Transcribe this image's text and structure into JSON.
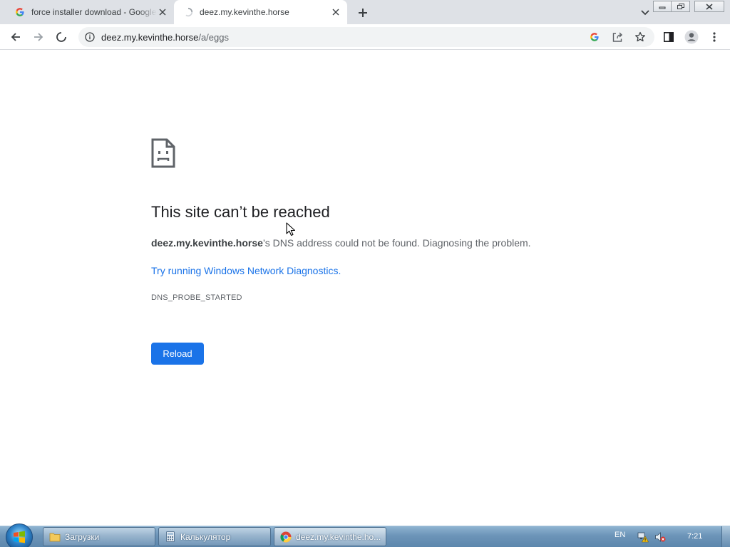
{
  "browser": {
    "tabs": [
      {
        "title": "force installer download - Google",
        "favicon": "google-icon",
        "active": false
      },
      {
        "title": "deez.my.kevinthe.horse",
        "favicon": "loading-spinner-icon",
        "active": true
      }
    ],
    "new_tab_icon": "plus-icon",
    "tab_search_icon": "chevron-down-icon",
    "window_controls": [
      "minimize-icon",
      "restore-icon",
      "close-icon"
    ],
    "toolbar": {
      "back_icon": "arrow-left-icon",
      "forward_icon": "arrow-right-icon",
      "stop_icon": "loading-spinner-icon",
      "site_info_icon": "info-icon",
      "url_host": "deez.my.kevinthe.horse",
      "url_path": "/a/eggs",
      "right_icons": [
        "google-icon",
        "share-icon",
        "star-icon",
        "side-panel-icon",
        "profile-icon",
        "more-vert-icon"
      ]
    }
  },
  "error_page": {
    "icon": "sad-document-icon",
    "title": "This site can’t be reached",
    "host": "deez.my.kevinthe.horse",
    "message_suffix": "’s DNS address could not be found. Diagnosing the problem.",
    "link_text": "Try running Windows Network Diagnostics.",
    "error_code": "DNS_PROBE_STARTED",
    "reload_label": "Reload"
  },
  "taskbar": {
    "start_icon": "windows-orb-icon",
    "buttons": [
      {
        "label": "Загрузки",
        "icon": "folder-icon",
        "active": false
      },
      {
        "label": "Калькулятор",
        "icon": "calculator-icon",
        "active": false
      },
      {
        "label": "deez.my.kevinthe.ho...",
        "icon": "chrome-icon",
        "active": true
      }
    ],
    "tray": {
      "language": "EN",
      "icons": [
        "network-warning-icon",
        "volume-muted-icon"
      ],
      "time": "7:21"
    }
  },
  "colors": {
    "accent": "#1a73e8",
    "tabstrip": "#dee1e6",
    "omnibox": "#f1f3f4",
    "text_primary": "#202124",
    "text_secondary": "#5f6368"
  }
}
